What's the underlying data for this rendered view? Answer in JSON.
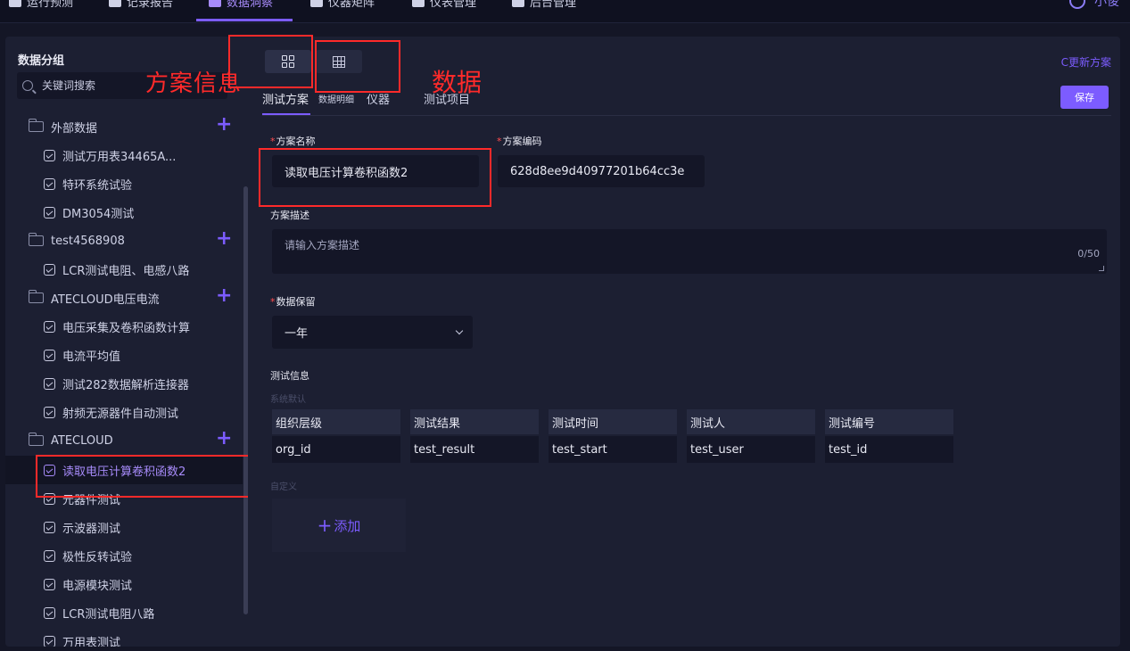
{
  "topnav": {
    "items": [
      {
        "label": "运行预测",
        "icon": "monitor-icon"
      },
      {
        "label": "记录报告",
        "icon": "document-icon"
      },
      {
        "label": "数据洞察",
        "icon": "monitor-icon",
        "active": true
      },
      {
        "label": "仪器矩阵",
        "icon": "keyboard-icon"
      },
      {
        "label": "仪表管理",
        "icon": "gear-icon"
      },
      {
        "label": "后台管理",
        "icon": "key-icon"
      }
    ],
    "user": "小俊"
  },
  "sidebar": {
    "title": "数据分组",
    "search_placeholder": "关键词搜索",
    "annotation": "方案信息",
    "groups": [
      {
        "label": "外部数据",
        "items": [
          "测试万用表34465A...",
          "特环系统试验",
          "DM3054测试"
        ]
      },
      {
        "label": "test4568908",
        "items": [
          "LCR测试电阻、电感八路"
        ]
      },
      {
        "label": "ATECLOUD电压电流",
        "items": [
          "电压采集及卷积函数计算",
          "电流平均值",
          "测试282数据解析连接器",
          "射频无源器件自动测试"
        ]
      },
      {
        "label": "ATECLOUD",
        "items": [
          "读取电压计算卷积函数2",
          "元器件测试",
          "示波器测试",
          "极性反转试验",
          "电源模块测试",
          "LCR测试电阻八路",
          "万用表测试"
        ]
      }
    ],
    "selected": "读取电压计算卷积函数2"
  },
  "main": {
    "annotation_data": "数据",
    "tabs": [
      "测试方案",
      "数据明细",
      "仪器",
      "测试项目"
    ],
    "update_link": "C更新方案",
    "save_label": "保存",
    "name_label": "方案名称",
    "name_value": "读取电压计算卷积函数2",
    "code_label": "方案编码",
    "code_value": "628d8ee9d40977201b64cc3e",
    "desc_label": "方案描述",
    "desc_placeholder": "请输入方案描述",
    "desc_count": "0/50",
    "retention_label": "数据保留",
    "retention_value": "一年",
    "info_title": "测试信息",
    "system_default": "系统默认",
    "info_headers": [
      "组织层级",
      "测试结果",
      "测试时间",
      "测试人",
      "测试编号"
    ],
    "info_values": [
      "org_id",
      "test_result",
      "test_start",
      "test_user",
      "test_id"
    ],
    "custom_label": "自定义",
    "add_label": "添加"
  }
}
